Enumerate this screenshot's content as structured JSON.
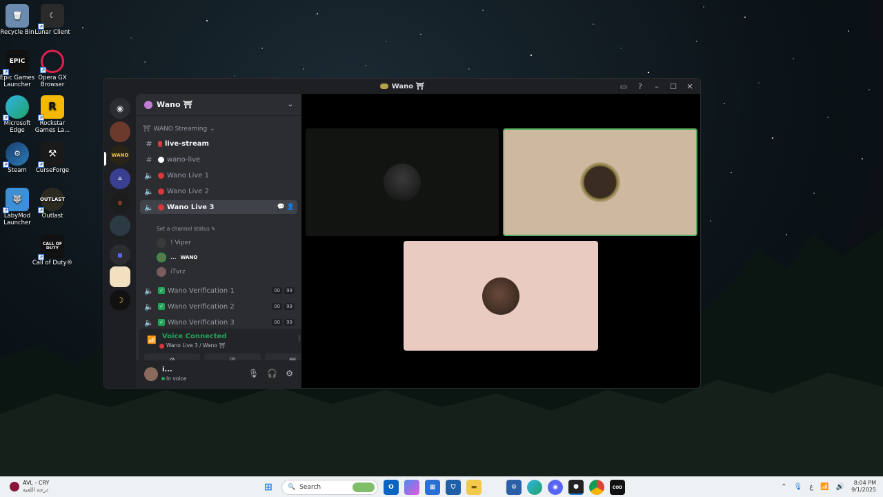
{
  "desktop": {
    "icons": [
      {
        "label": "Recycle Bin",
        "glyph": "trash-icon"
      },
      {
        "label": "Lunar Client",
        "glyph": "lunar-icon"
      },
      {
        "label": "Epic Games Launcher",
        "glyph": "epic-icon",
        "text": "EPIC"
      },
      {
        "label": "Opera GX Browser",
        "glyph": "opera-icon"
      },
      {
        "label": "Microsoft Edge",
        "glyph": "edge-icon"
      },
      {
        "label": "Rockstar Games La...",
        "glyph": "rockstar-icon",
        "text": "R"
      },
      {
        "label": "Steam",
        "glyph": "steam-icon"
      },
      {
        "label": "CurseForge",
        "glyph": "curseforge-icon"
      },
      {
        "label": "LabyMod Launcher",
        "glyph": "labymod-icon"
      },
      {
        "label": "Outlast",
        "glyph": "outlast-icon"
      },
      {
        "label": "Call of Duty®",
        "glyph": "cod-icon",
        "text": "CALL OF DUTY"
      }
    ]
  },
  "window": {
    "title": "Wano ⛩"
  },
  "guild": {
    "name": "Wano ⛩",
    "category": "WANO Streaming",
    "channels": [
      {
        "name": "live-stream",
        "type": "text"
      },
      {
        "name": "wano-live",
        "type": "text"
      },
      {
        "name": "Wano Live 1",
        "type": "voice"
      },
      {
        "name": "Wano Live 2",
        "type": "voice"
      },
      {
        "name": "Wano Live 3",
        "type": "voice"
      },
      {
        "name": "Wano Verification 1",
        "type": "voice",
        "count_a": "00",
        "count_b": "99"
      },
      {
        "name": "Wano Verification 2",
        "type": "voice",
        "count_a": "00",
        "count_b": "99"
      },
      {
        "name": "Wano Verification 3",
        "type": "voice",
        "count_a": "00",
        "count_b": "99"
      }
    ],
    "channel_status": "Set a channel status ✎",
    "voice_users": [
      {
        "name": "! Viper",
        "tag": ""
      },
      {
        "name": "...",
        "tag": "WANO"
      },
      {
        "name": "iTvrz",
        "tag": ""
      }
    ]
  },
  "voice": {
    "status": "Voice Connected",
    "channel": "Wano Live 3 / Wano ⛩"
  },
  "user": {
    "name": "i...",
    "status": "In voice"
  },
  "colors": {
    "accent_green": "#23a559",
    "tile_highlight": "#57b05b",
    "tile_beige": "#cdb8a0",
    "tile_pink": "#e9cbc1",
    "tile_dark": "#121412"
  },
  "taskbar": {
    "weather_title": "AVL - CRY",
    "weather_sub": "درجة اللعبة",
    "search_placeholder": "Search",
    "lang": "ع",
    "time": "8:04 PM",
    "date": "9/1/2025"
  }
}
